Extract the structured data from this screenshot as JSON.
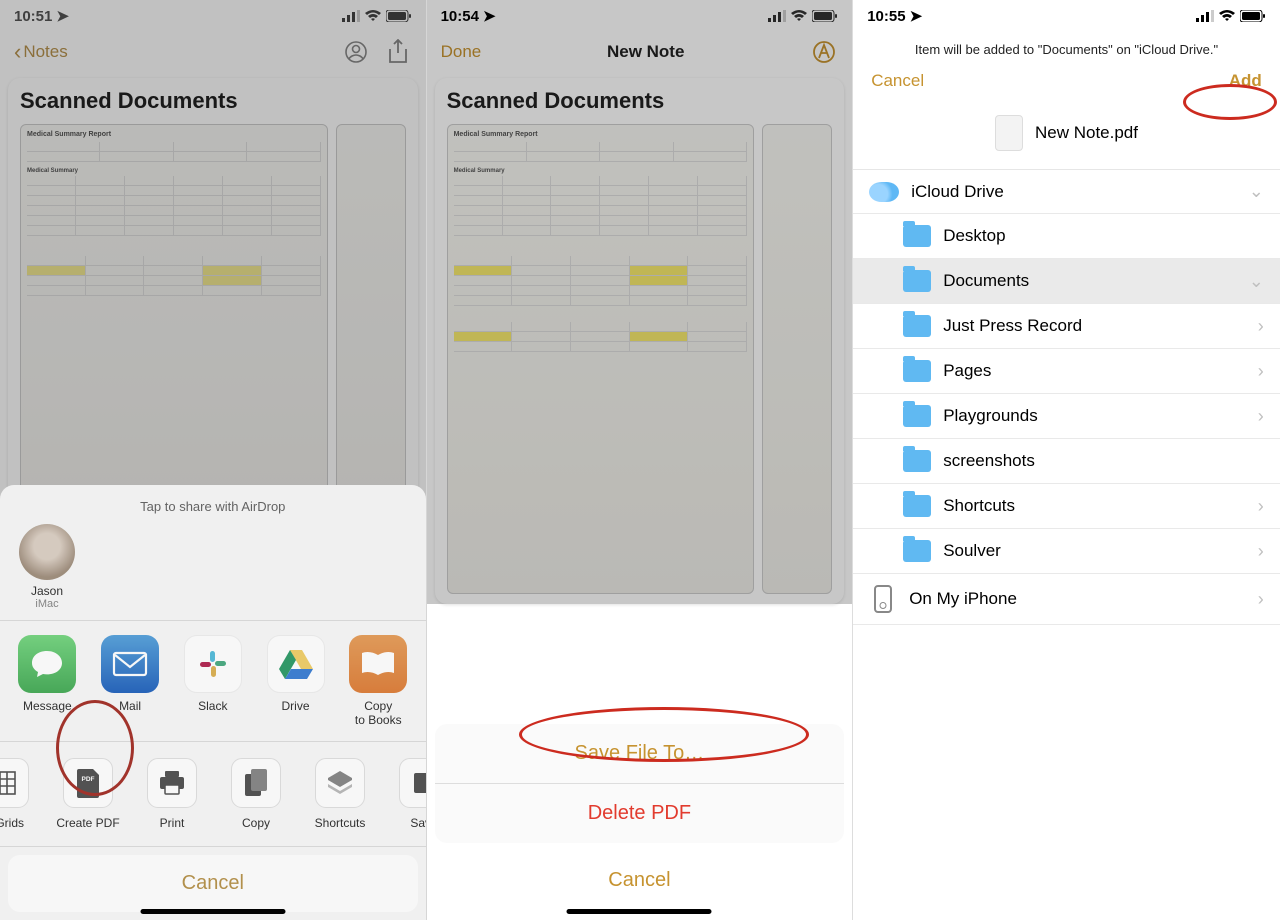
{
  "panel1": {
    "time": "10:51",
    "back": "Notes",
    "doc_title": "Scanned Documents",
    "sheet_header": "Tap to share with AirDrop",
    "contact_name": "Jason",
    "contact_sub": "iMac",
    "apps": [
      "Message",
      "Mail",
      "Slack",
      "Drive",
      "Copy\nto Books"
    ],
    "actions": [
      "& Grids",
      "Create PDF",
      "Print",
      "Copy",
      "Shortcuts",
      "Save"
    ],
    "cancel": "Cancel"
  },
  "panel2": {
    "time": "10:54",
    "done": "Done",
    "title": "New Note",
    "doc_title": "Scanned Documents",
    "save": "Save File To…",
    "delete": "Delete PDF",
    "cancel": "Cancel"
  },
  "panel3": {
    "time": "10:55",
    "msg": "Item will be added to \"Documents\" on \"iCloud Drive.\"",
    "cancel": "Cancel",
    "add": "Add",
    "filename": "New Note.pdf",
    "drive": "iCloud Drive",
    "folders": [
      "Desktop",
      "Documents",
      "Just Press Record",
      "Pages",
      "Playgrounds",
      "screenshots",
      "Shortcuts",
      "Soulver"
    ],
    "local": "On My iPhone"
  }
}
